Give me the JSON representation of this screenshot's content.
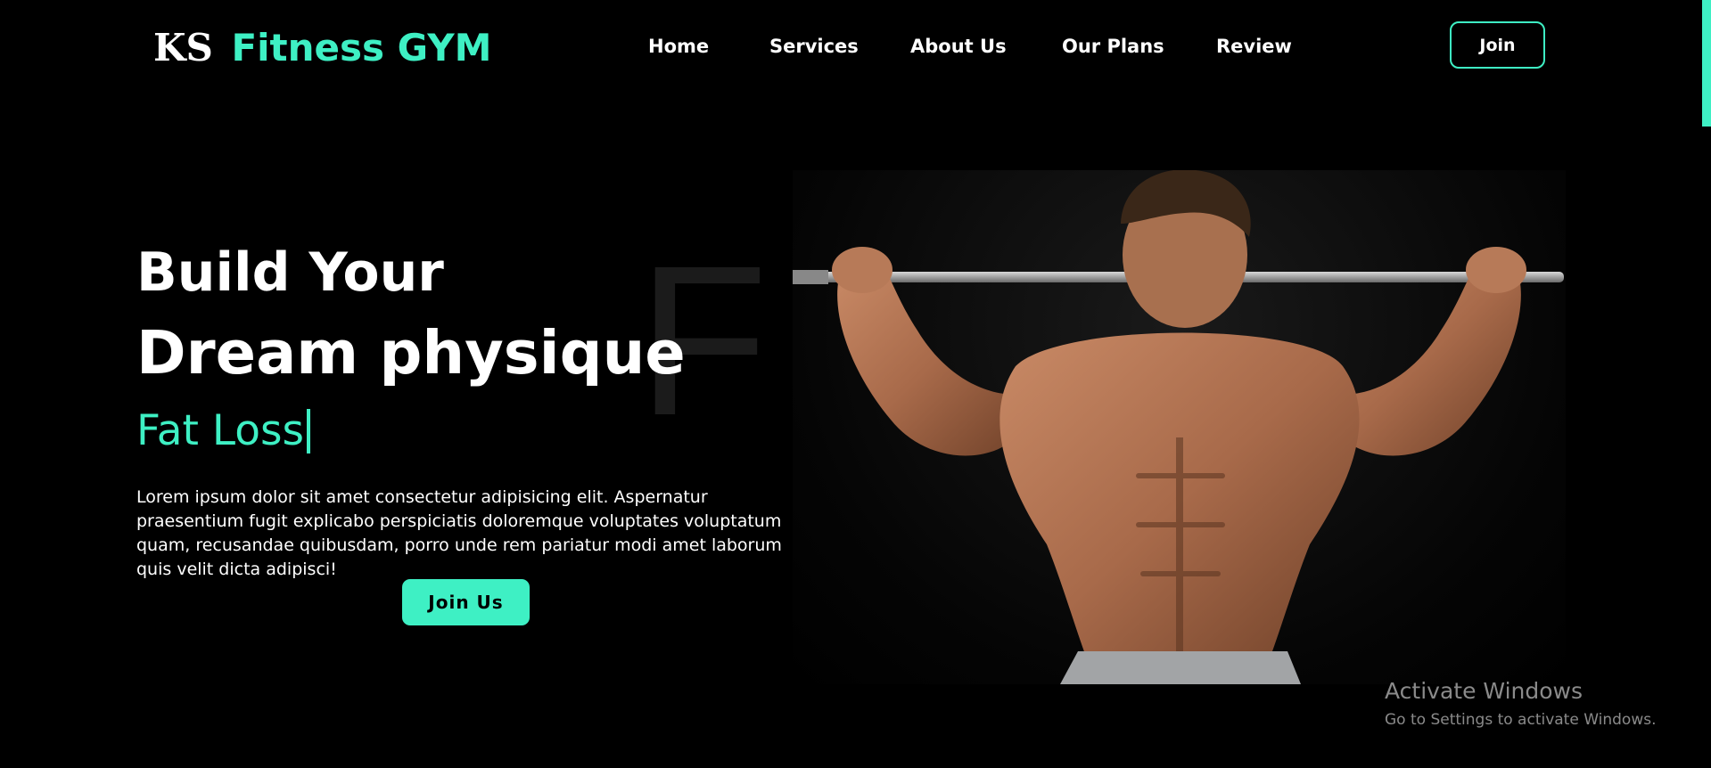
{
  "colors": {
    "accent": "#3ef0c4",
    "background": "#000000",
    "text": "#ffffff"
  },
  "header": {
    "logo_prefix": "KS",
    "logo_brand": "Fitness GYM",
    "nav": [
      "Home",
      "Services",
      "About Us",
      "Our Plans",
      "Review"
    ],
    "join_label": "Join"
  },
  "hero": {
    "watermark": "FI",
    "title_line1": "Build Your",
    "title_line2": "Dream physique",
    "typed_text": "Fat Loss",
    "description": "Lorem ipsum dolor sit amet consectetur adipisicing elit. Aspernatur praesentium fugit explicabo perspiciatis doloremque voluptates voluptatum quam, recusandae quibusdam, porro unde rem pariatur modi amet laborum quis velit dicta adipisci!",
    "cta_label": "Join Us",
    "image_icon": "bodybuilder-photo"
  },
  "os_overlay": {
    "title": "Activate Windows",
    "subtitle": "Go to Settings to activate Windows."
  }
}
